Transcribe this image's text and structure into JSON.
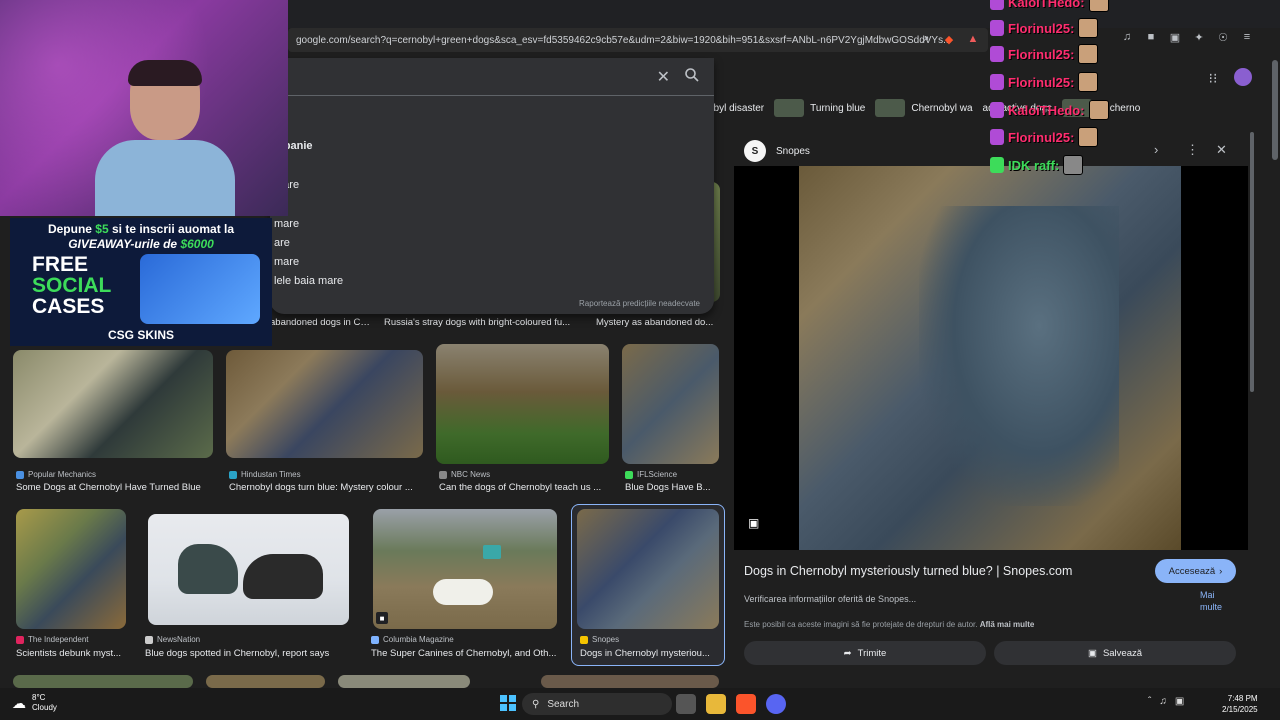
{
  "browser": {
    "url": "google.com/search?q=cernobyl+green+dogs&sca_esv=fd5359462c9cb57e&udm=2&biw=1920&bih=951&sxsrf=ANbL-n6PV2YgjMdbwGOSddVYs..."
  },
  "search_dropdown": {
    "suggestions": [
      "mpanie",
      "mare",
      "mare",
      "are",
      "mare",
      "lele baia mare"
    ],
    "report_text": "Raportează predicțiile neadecvate"
  },
  "chips": [
    {
      "label": "obyl disaster"
    },
    {
      "label": "Turning blue"
    },
    {
      "label": "Chernobyl wa"
    },
    {
      "label": "adioactive dogs"
    },
    {
      "label": "er cherno"
    }
  ],
  "row1_captions": [
    "abandoned dogs in Che...",
    "Russia's stray dogs with bright-coloured fu...",
    "Mystery as abandoned do..."
  ],
  "results": [
    {
      "source": "Popular Mechanics",
      "caption": "Some Dogs at Chernobyl Have Turned Blue",
      "src_color": "#4a90e2"
    },
    {
      "source": "Hindustan Times",
      "caption": "Chernobyl dogs turn blue: Mystery colour ...",
      "src_color": "#2aa3c7"
    },
    {
      "source": "NBC News",
      "caption": "Can the dogs of Chernobyl teach us ...",
      "src_color": "#888888"
    },
    {
      "source": "IFLScience",
      "caption": "Blue Dogs Have B...",
      "src_color": "#3ddc5a"
    },
    {
      "source": "The Independent",
      "caption": "Scientists debunk myst...",
      "src_color": "#e0245e"
    },
    {
      "source": "NewsNation",
      "caption": "Blue dogs spotted in Chernobyl, report says",
      "src_color": "#cccccc"
    },
    {
      "source": "Columbia Magazine",
      "caption": "The Super Canines of Chernobyl, and Oth...",
      "src_color": "#7fb3ff"
    },
    {
      "source": "Snopes",
      "caption": "Dogs in Chernobyl mysteriou...",
      "src_color": "#f5c400"
    }
  ],
  "panel": {
    "source": "Snopes",
    "title": "Dogs in Chernobyl mysteriously turned blue? | Snopes.com",
    "visit_label": "Accesează",
    "verify_text": "Verificarea informațiilor oferită de Snopes...",
    "more_label": "Mai multe",
    "copyright_text": "Este posibil ca aceste imagini să fie protejate de drepturi de autor.",
    "learn_more": "Află mai multe",
    "share_label": "Trimite",
    "save_label": "Salvează"
  },
  "overlay": {
    "promo_line1_pre": "Depune ",
    "promo_amount1": "$5",
    "promo_line1_post": " si te inscrii auomat la",
    "promo_line2_pre": "GIVEAWAY-urile de ",
    "promo_amount2": "$6000",
    "promo_free": "FREE",
    "promo_social": "SOCIAL",
    "promo_cases": "CASES",
    "promo_brand": "CSG SKINS",
    "chat": [
      {
        "name": "KaloiTHedo:"
      },
      {
        "name": "Florinul25:"
      },
      {
        "name": "Florinul25:"
      },
      {
        "name": "Florinul25:"
      },
      {
        "name": "KaloiTHedo:"
      },
      {
        "name": "Florinul25:"
      },
      {
        "name": "IDK raff:"
      }
    ]
  },
  "taskbar": {
    "temp": "8°C",
    "weather": "Cloudy",
    "search_label": "Search",
    "time": "7:48 PM",
    "date": "2/15/2025"
  }
}
